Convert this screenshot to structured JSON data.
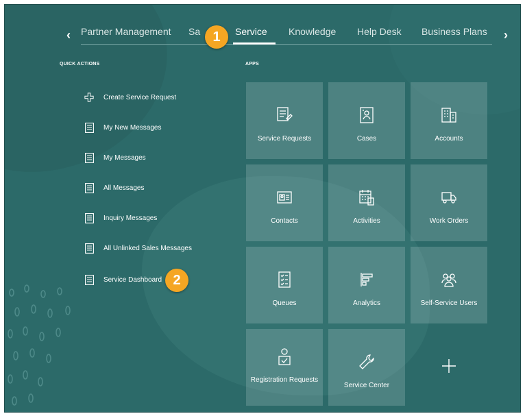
{
  "nav": {
    "tabs": [
      {
        "label": "Partner Management",
        "active": false
      },
      {
        "label": "Sa",
        "active": false
      },
      {
        "label": "Service",
        "active": true
      },
      {
        "label": "Knowledge",
        "active": false
      },
      {
        "label": "Help Desk",
        "active": false
      },
      {
        "label": "Business Plans",
        "active": false
      }
    ],
    "prev_icon": "chevron-left-icon",
    "next_icon": "chevron-right-icon"
  },
  "callouts": [
    "1",
    "2"
  ],
  "quick_actions": {
    "heading": "QUICK ACTIONS",
    "items": [
      {
        "label": "Create Service Request",
        "icon": "plus-outline-icon"
      },
      {
        "label": "My New Messages",
        "icon": "document-icon"
      },
      {
        "label": "My Messages",
        "icon": "document-icon"
      },
      {
        "label": "All Messages",
        "icon": "document-icon"
      },
      {
        "label": "Inquiry Messages",
        "icon": "document-icon"
      },
      {
        "label": "All Unlinked Sales Messages",
        "icon": "document-icon"
      },
      {
        "label": "Service Dashboard",
        "icon": "document-icon"
      }
    ]
  },
  "apps": {
    "heading": "APPS",
    "tiles": [
      {
        "label": "Service Requests",
        "icon": "service-request-icon"
      },
      {
        "label": "Cases",
        "icon": "cases-icon"
      },
      {
        "label": "Accounts",
        "icon": "building-icon"
      },
      {
        "label": "Contacts",
        "icon": "contact-card-icon"
      },
      {
        "label": "Activities",
        "icon": "calendar-icon"
      },
      {
        "label": "Work Orders",
        "icon": "truck-icon"
      },
      {
        "label": "Queues",
        "icon": "checklist-icon"
      },
      {
        "label": "Analytics",
        "icon": "bar-chart-icon"
      },
      {
        "label": "Self-Service Users",
        "icon": "users-group-icon"
      },
      {
        "label": "Registration Requests",
        "icon": "registration-icon"
      },
      {
        "label": "Service Center",
        "icon": "wrench-icon"
      }
    ],
    "add_icon": "plus-icon"
  },
  "colors": {
    "background": "#2c6a69",
    "tile": "#4f8685",
    "callout": "#f5a623",
    "text": "#ffffff"
  }
}
